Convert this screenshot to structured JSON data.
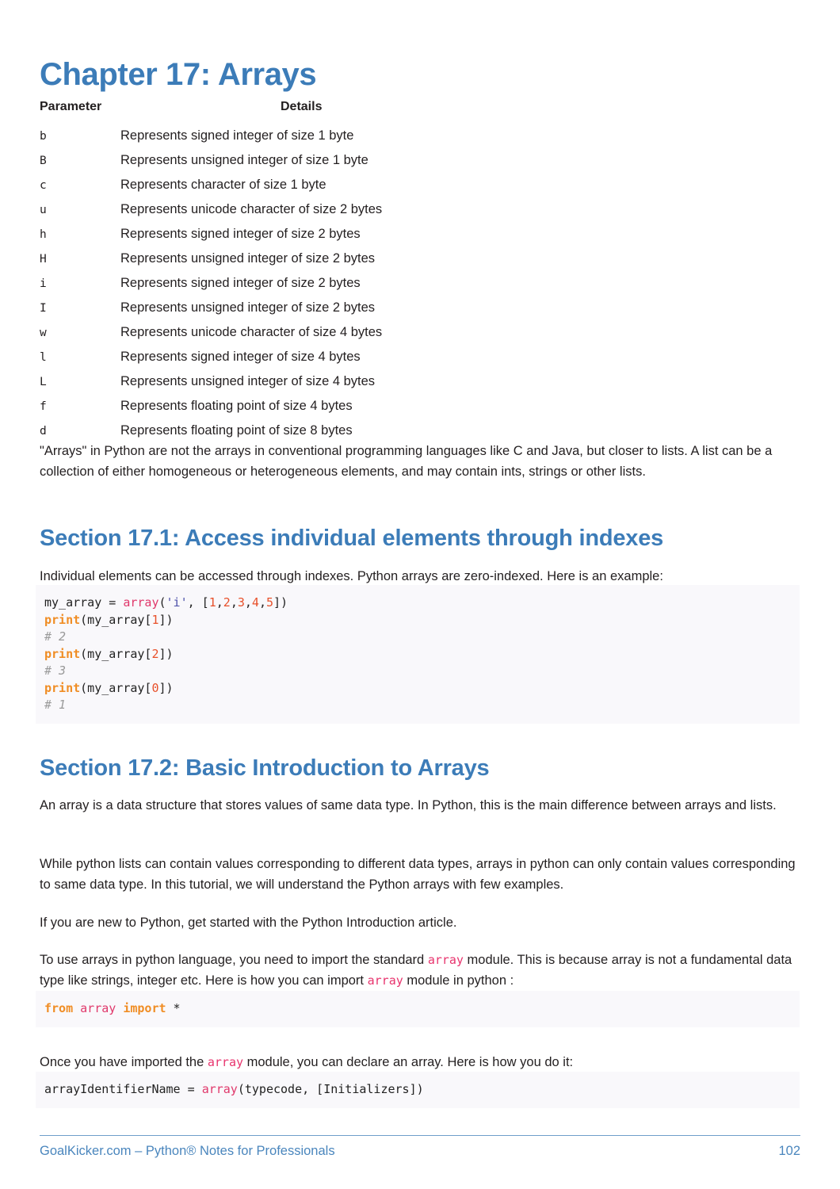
{
  "chapter": {
    "title": "Chapter 17: Arrays"
  },
  "param_table": {
    "headers": {
      "parameter": "Parameter",
      "details": "Details"
    },
    "rows": [
      {
        "param": "b",
        "details": "Represents signed integer of size 1 byte"
      },
      {
        "param": "B",
        "details": "Represents unsigned integer of size 1 byte"
      },
      {
        "param": "c",
        "details": "Represents character of size 1 byte"
      },
      {
        "param": "u",
        "details": "Represents unicode character of size 2 bytes"
      },
      {
        "param": "h",
        "details": "Represents signed integer of size 2 bytes"
      },
      {
        "param": "H",
        "details": "Represents unsigned integer of size 2 bytes"
      },
      {
        "param": "i",
        "details": "Represents signed integer of size 2 bytes"
      },
      {
        "param": "I",
        "details": "Represents unsigned integer of size 2 bytes"
      },
      {
        "param": "w",
        "details": "Represents unicode character of size 4 bytes"
      },
      {
        "param": "l",
        "details": "Represents signed integer of size 4 bytes"
      },
      {
        "param": "L",
        "details": "Represents unsigned integer of size 4 bytes"
      },
      {
        "param": "f",
        "details": "Represents floating point of size 4 bytes"
      },
      {
        "param": "d",
        "details": "Represents floating point of size 8 bytes"
      }
    ]
  },
  "intro_paragraph": "\"Arrays\" in Python are not the arrays in conventional programming languages like C and Java, but closer to lists. A list can be a collection of either homogeneous or heterogeneous elements, and may contain ints, strings or other lists.",
  "section_17_1": {
    "heading": "Section 17.1: Access individual elements through indexes",
    "intro": "Individual elements can be accessed through indexes. Python arrays are zero-indexed. Here is an example:",
    "code_lines": [
      [
        {
          "t": "my_array ",
          "c": "plain"
        },
        {
          "t": "= ",
          "c": "plain"
        },
        {
          "t": "array",
          "c": "name"
        },
        {
          "t": "(",
          "c": "plain"
        },
        {
          "t": "'i'",
          "c": "str"
        },
        {
          "t": ", [",
          "c": "plain"
        },
        {
          "t": "1",
          "c": "num"
        },
        {
          "t": ",",
          "c": "plain"
        },
        {
          "t": "2",
          "c": "num"
        },
        {
          "t": ",",
          "c": "plain"
        },
        {
          "t": "3",
          "c": "num"
        },
        {
          "t": ",",
          "c": "plain"
        },
        {
          "t": "4",
          "c": "num"
        },
        {
          "t": ",",
          "c": "plain"
        },
        {
          "t": "5",
          "c": "num"
        },
        {
          "t": "])",
          "c": "plain"
        }
      ],
      [
        {
          "t": "print",
          "c": "fn"
        },
        {
          "t": "(my_array[",
          "c": "plain"
        },
        {
          "t": "1",
          "c": "num"
        },
        {
          "t": "])",
          "c": "plain"
        }
      ],
      [
        {
          "t": "# 2",
          "c": "cmt"
        }
      ],
      [
        {
          "t": "print",
          "c": "fn"
        },
        {
          "t": "(my_array[",
          "c": "plain"
        },
        {
          "t": "2",
          "c": "num"
        },
        {
          "t": "])",
          "c": "plain"
        }
      ],
      [
        {
          "t": "# 3",
          "c": "cmt"
        }
      ],
      [
        {
          "t": "print",
          "c": "fn"
        },
        {
          "t": "(my_array[",
          "c": "plain"
        },
        {
          "t": "0",
          "c": "num"
        },
        {
          "t": "])",
          "c": "plain"
        }
      ],
      [
        {
          "t": "# 1",
          "c": "cmt"
        }
      ]
    ]
  },
  "section_17_2": {
    "heading": "Section 17.2: Basic Introduction to Arrays",
    "para_1": "An array is a data structure that stores values of same data type. In Python, this is the main difference between arrays and lists.",
    "para_2": "While python lists can contain values corresponding to different data types, arrays in python can only contain values corresponding to same data type. In this tutorial, we will understand the Python arrays with few examples.",
    "para_3": "If you are new to Python, get started with the Python Introduction article.",
    "para_4_part_1": "To use arrays in python language, you need to import the standard ",
    "para_4_code_1": "array",
    "para_4_part_2": " module. This is because array is not a fundamental data type like strings, integer etc. Here is how you can import ",
    "para_4_code_2": "array",
    "para_4_part_3": " module in python :",
    "code_lines_1": [
      [
        {
          "t": "from",
          "c": "kw"
        },
        {
          "t": " ",
          "c": "plain"
        },
        {
          "t": "array",
          "c": "name"
        },
        {
          "t": " ",
          "c": "plain"
        },
        {
          "t": "import",
          "c": "kw"
        },
        {
          "t": " *",
          "c": "plain"
        }
      ]
    ],
    "para_5_part_1": "Once you have imported the ",
    "para_5_code_1": "array",
    "para_5_part_2": " module, you can declare an array. Here is how you do it:",
    "code_lines_2": [
      [
        {
          "t": "arrayIdentifierName ",
          "c": "plain"
        },
        {
          "t": "= ",
          "c": "plain"
        },
        {
          "t": "array",
          "c": "name"
        },
        {
          "t": "(typecode, [Initializers])",
          "c": "plain"
        }
      ]
    ]
  },
  "footer": {
    "left": "GoalKicker.com – Python® Notes for Professionals",
    "page_number": "102"
  },
  "colors": {
    "heading_blue": "#3c7cb8",
    "footer_blue": "#4a86bd",
    "code_bg": "#f9f8fb",
    "code_name": "#e0386b",
    "code_keyword": "#f08d24",
    "code_number": "#e8502a",
    "code_string": "#4b4fa8",
    "code_comment": "#9a9a9a",
    "body_text": "#231f20"
  }
}
